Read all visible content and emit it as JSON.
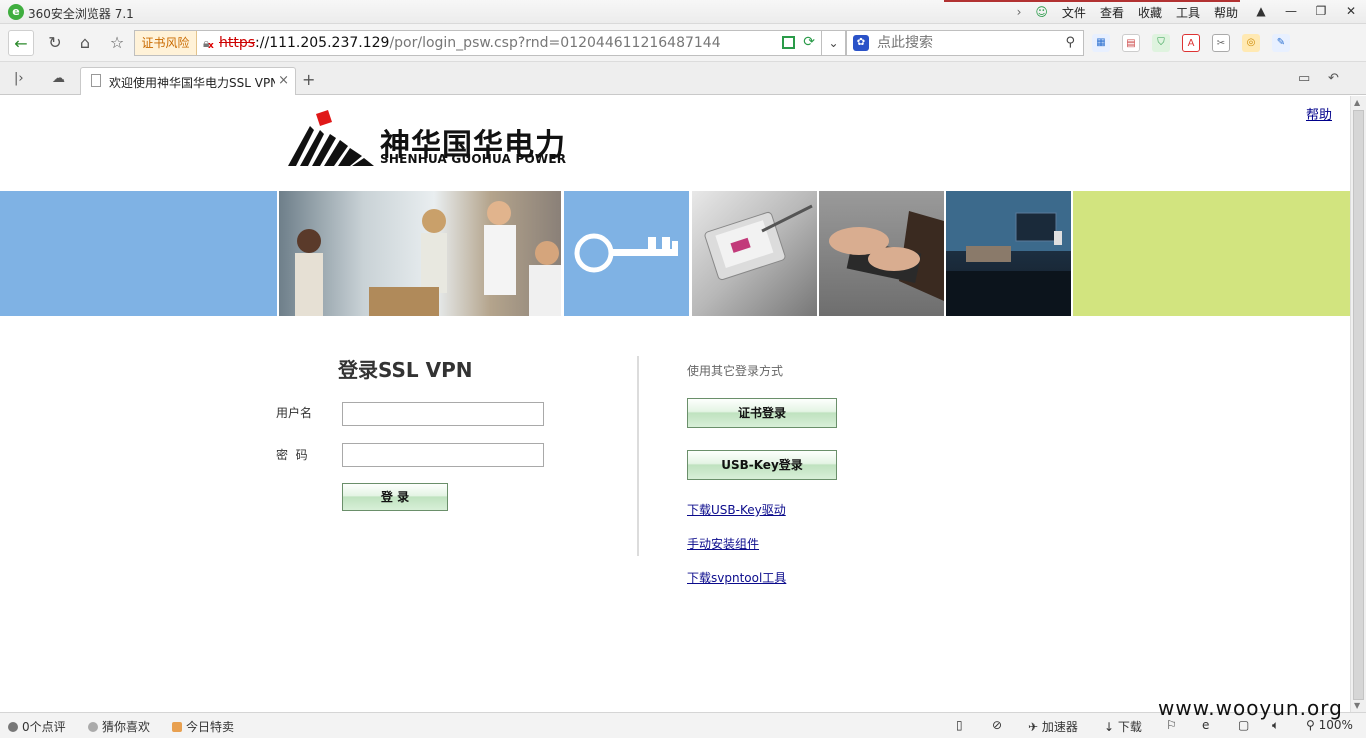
{
  "titlebar": {
    "app_icon": "e",
    "title": "360安全浏览器 7.1",
    "menu": [
      "文件",
      "查看",
      "收藏",
      "工具",
      "帮助"
    ],
    "window_buttons": [
      "minimize",
      "restore",
      "close"
    ]
  },
  "navbar": {
    "cert_warning": "证书风险",
    "url_protocol": "https",
    "url_host": "://111.205.237.129",
    "url_path": "/por/login_psw.csp?rnd=0120446112164871​44",
    "search_placeholder": "点此搜索"
  },
  "tab": {
    "title": "欢迎使用神华国华电力SSL VPN!"
  },
  "page": {
    "help_link": "帮助",
    "brand_cn": "神华国华电力",
    "brand_en": "SHENHUA GUOHUA POWER",
    "login_title": "登录SSL VPN",
    "username_label": "用户名",
    "password_label": "密  码",
    "login_button": "登 录",
    "other_methods": "使用其它登录方式",
    "cert_login_button": "证书登录",
    "usbkey_login_button": "USB-Key登录",
    "link_usbkey_driver": "下载USB-Key驱动",
    "link_manual_install": "手动安装组件",
    "link_svpntool": "下载svpntool工具"
  },
  "statusbar": {
    "comments": "0个点评",
    "guess": "猜你喜欢",
    "deals": "今日特卖",
    "accelerator": "加速器",
    "download": "下载",
    "zoom": "100%"
  },
  "watermark": "www.wooyun.org",
  "colors": {
    "banner_blue": "#7fb2e4",
    "banner_green": "#d2e47f",
    "button_green": "#bfe2bf",
    "link": "#0b0b8c",
    "cert_warning": "#c96a00"
  }
}
